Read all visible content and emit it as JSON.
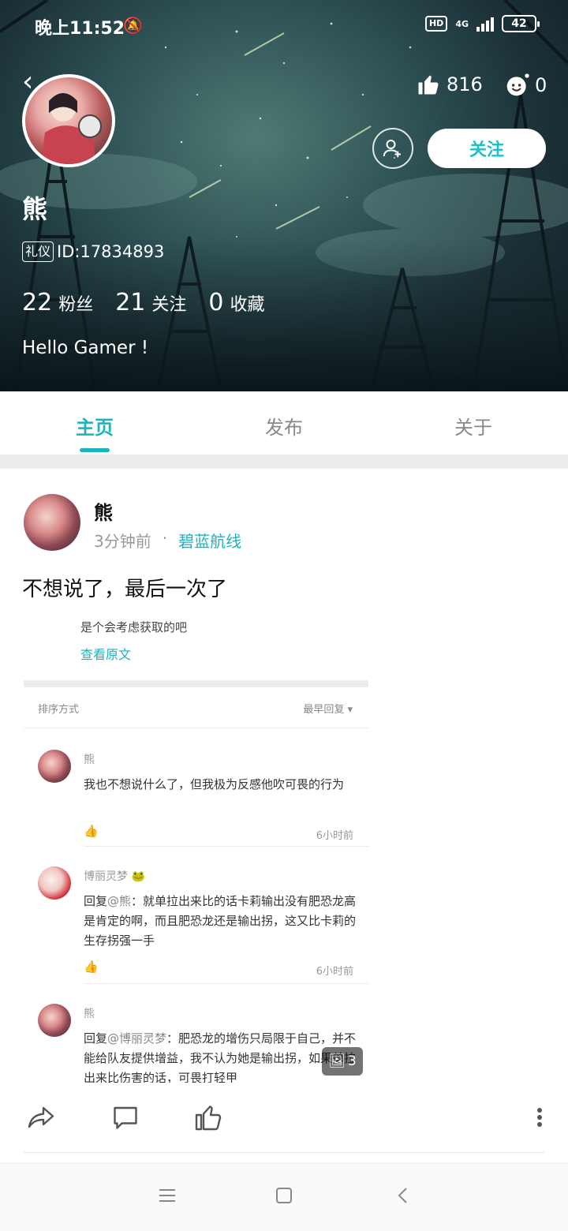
{
  "status_bar": {
    "time": "晚上11:52",
    "hd": "HD",
    "network": "4G",
    "battery": "42"
  },
  "profile": {
    "name": "熊",
    "badge": "礼仪",
    "id_text": "ID:17834893",
    "likes": "816",
    "smiles": "0",
    "follow_label": "关注",
    "stats": [
      {
        "num": "22",
        "label": "粉丝"
      },
      {
        "num": "21",
        "label": "关注"
      },
      {
        "num": "0",
        "label": "收藏"
      }
    ],
    "bio": "Hello Gamer !"
  },
  "tabs": [
    {
      "label": "主页",
      "active": true
    },
    {
      "label": "发布",
      "active": false
    },
    {
      "label": "关于",
      "active": false
    }
  ],
  "post": {
    "author": "熊",
    "time": "3分钟前",
    "dot": "·",
    "game": "碧蓝航线",
    "text": "不想说了，最后一次了",
    "image_count": "3",
    "screenshot": {
      "cut_text": "是个会考虑获取的吧",
      "view_original": "查看原文",
      "sort_label": "排序方式",
      "sort_value": "最早回复 ▾",
      "comments": [
        {
          "name": "熊",
          "text": "我也不想说什么了，但我极为反感他吹可畏的行为",
          "time": "6小时前"
        },
        {
          "name": "博丽灵梦 🐸",
          "reply_prefix": "回复",
          "at": "@熊",
          "text": "：就单拉出来比的话卡莉输出没有肥恐龙高是肯定的啊，而且肥恐龙还是输出拐，这又比卡莉的生存拐强一手",
          "time": "6小时前"
        },
        {
          "name": "熊",
          "reply_prefix": "回复",
          "at": "@博丽灵梦",
          "text": "：肥恐龙的增伤只局限于自己，并不能给队友提供增益，我不认为她是输出拐，如果单拉出来比伤害的话，可畏打轻甲"
        }
      ]
    }
  }
}
